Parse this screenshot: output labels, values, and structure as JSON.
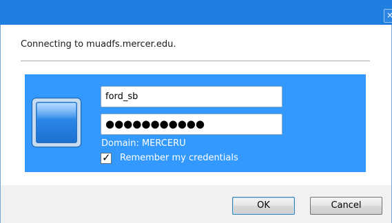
{
  "window": {
    "close_glyph": "×"
  },
  "dialog": {
    "connecting_text": "Connecting to muadfs.mercer.edu.",
    "username_value": "ford_sb",
    "password_masked": "●●●●●●●●●●●",
    "domain_text": "Domain: MERCERU",
    "remember_label": "Remember my credentials",
    "remember_checked": true,
    "check_glyph": "✓",
    "ok_label": "OK",
    "cancel_label": "Cancel"
  },
  "colors": {
    "title_bar": "#1e7fe0",
    "tile_accent": "#3399ff",
    "footer": "#f1f1f1"
  },
  "icons": {
    "user_tile": "user-tile-icon",
    "close": "close-icon",
    "checkbox_check": "check-icon"
  }
}
